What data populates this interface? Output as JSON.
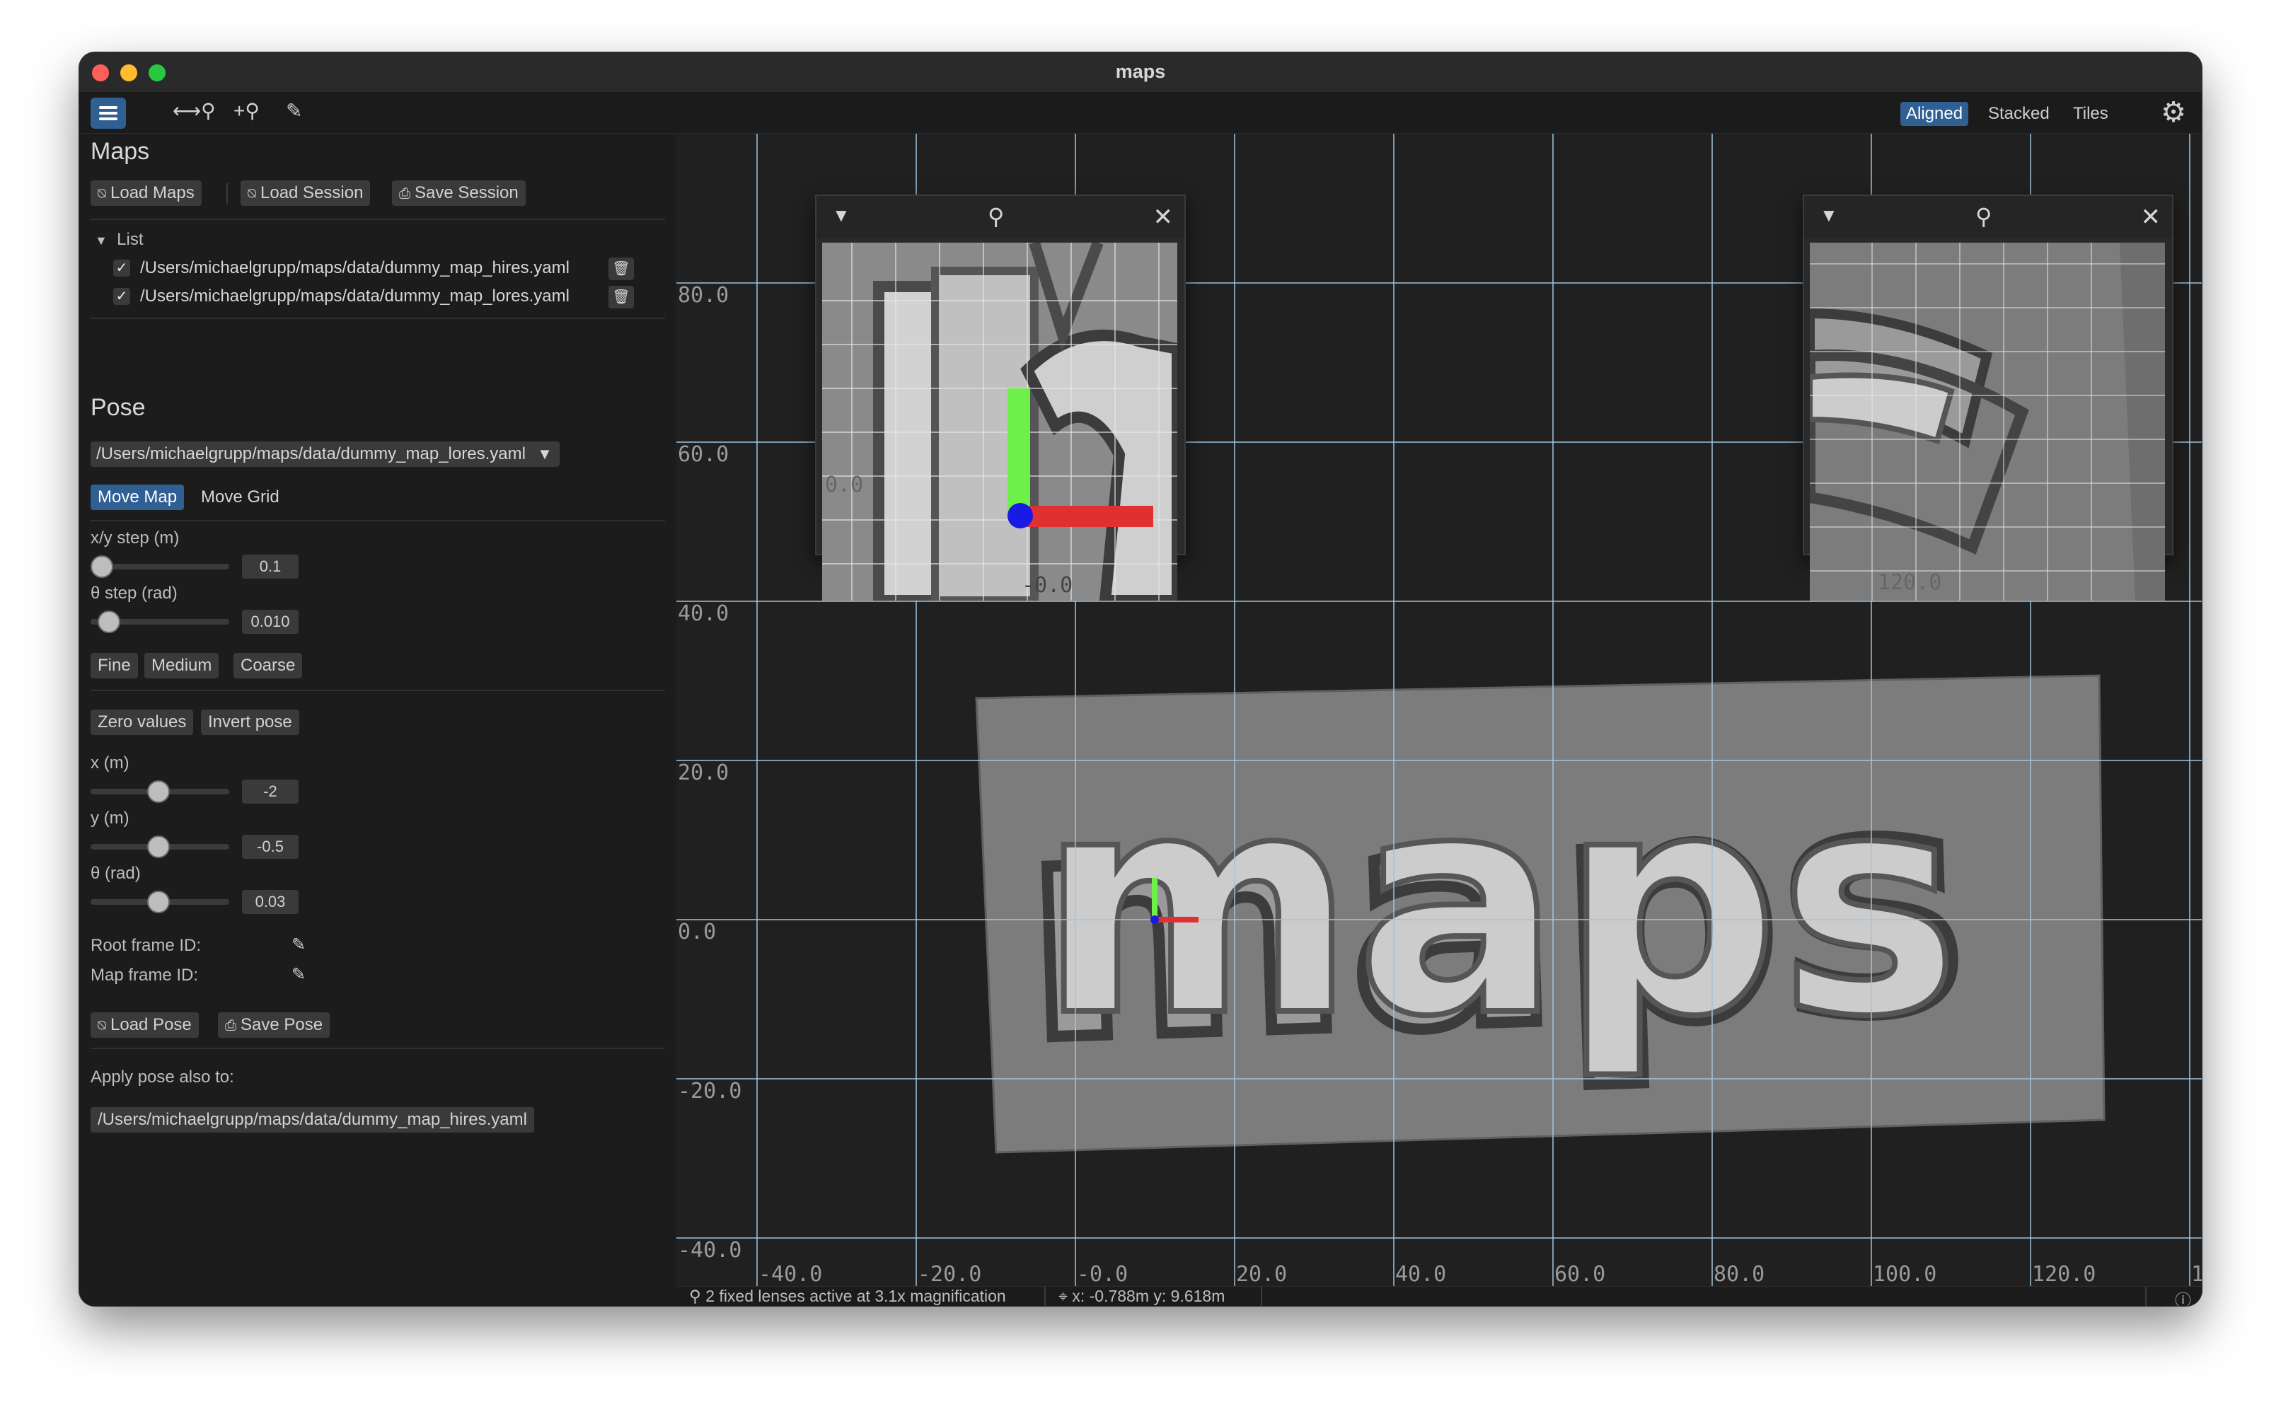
{
  "window": {
    "title": "maps"
  },
  "toolbar": {
    "icons": [
      "menu-icon",
      "ruler-search-icon",
      "zoom-in-icon",
      "pencil-icon"
    ],
    "views": [
      "Aligned",
      "Stacked",
      "Tiles"
    ],
    "active_view": "Aligned"
  },
  "sidebar": {
    "maps": {
      "title": "Maps",
      "load_maps": "Load Maps",
      "load_session": "Load Session",
      "save_session": "Save Session",
      "list_label": "List",
      "items": [
        {
          "path": "/Users/michaelgrupp/maps/data/dummy_map_hires.yaml",
          "checked": true
        },
        {
          "path": "/Users/michaelgrupp/maps/data/dummy_map_lores.yaml",
          "checked": true
        }
      ]
    },
    "pose": {
      "title": "Pose",
      "selected_map": "/Users/michaelgrupp/maps/data/dummy_map_lores.yaml",
      "move_map": "Move Map",
      "move_grid": "Move Grid",
      "xy_step_label": "x/y step (m)",
      "xy_step_value": "0.1",
      "theta_step_label": "θ step (rad)",
      "theta_step_value": "0.010",
      "fine": "Fine",
      "medium": "Medium",
      "coarse": "Coarse",
      "zero_values": "Zero values",
      "invert_pose": "Invert pose",
      "x_label": "x (m)",
      "x_value": "-2",
      "y_label": "y (m)",
      "y_value": "-0.5",
      "theta_label": "θ (rad)",
      "theta_value": "0.03",
      "root_frame_label": "Root frame ID:",
      "map_frame_label": "Map frame ID:",
      "load_pose": "Load Pose",
      "save_pose": "Save Pose",
      "apply_also_label": "Apply pose also to:",
      "apply_also_item": "/Users/michaelgrupp/maps/data/dummy_map_hires.yaml"
    }
  },
  "canvas": {
    "map_text": "maps",
    "y_ticks": [
      "80.0",
      "60.0",
      "40.0",
      "20.0",
      "0.0",
      "-20.0",
      "-40.0"
    ],
    "x_ticks": [
      "-40.0",
      "-20.0",
      "-0.0",
      "20.0",
      "40.0",
      "60.0",
      "80.0",
      "100.0",
      "120.0",
      "1"
    ],
    "lens1_labels": {
      "x": "-0.0",
      "y": "0.0"
    },
    "lens2_labels": {
      "x": "120.0"
    }
  },
  "status": {
    "lenses": "2 fixed lenses active at 3.1x magnification",
    "coords": "x: -0.788m  y: 9.618m"
  },
  "colors": {
    "accent": "#2f5f93",
    "axis_x": "#e03030",
    "axis_y": "#6ef04a",
    "origin": "#1a1ae6",
    "grid": "#9fc4e0"
  }
}
